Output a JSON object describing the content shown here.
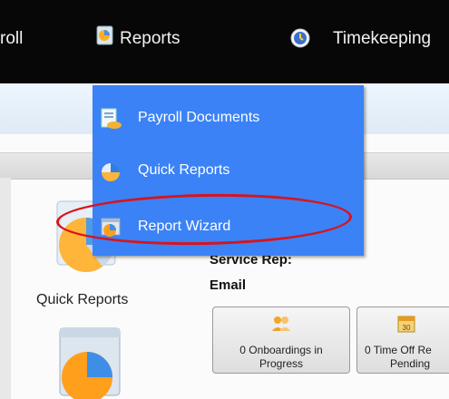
{
  "nav": {
    "payroll_label": "roll",
    "reports_label": "Reports",
    "timekeeping_label": "Timekeeping"
  },
  "dropdown": {
    "items": [
      {
        "label": "Payroll Documents",
        "icon": "payroll-documents-icon"
      },
      {
        "label": "Quick Reports",
        "icon": "quick-reports-icon"
      },
      {
        "label": "Report Wizard",
        "icon": "report-wizard-icon"
      }
    ]
  },
  "main": {
    "quick_reports_label": "Quick Reports",
    "service_rep_label": "Service Rep:",
    "email_label": "Email"
  },
  "cards": [
    {
      "line1": "0 Onboardings in",
      "line2": "Progress",
      "icon": "people-icon"
    },
    {
      "line1": "0 Time Off Re",
      "line2": "Pending",
      "icon": "calendar-icon"
    }
  ],
  "colors": {
    "menu": "#3b82f6",
    "topbar": "#070707",
    "highlight": "#d8141b"
  }
}
